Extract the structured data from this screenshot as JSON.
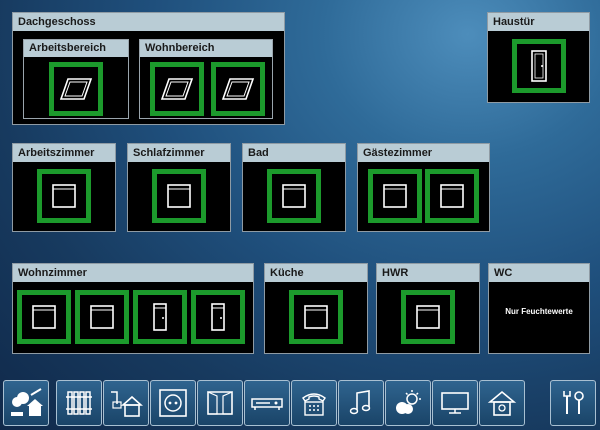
{
  "dachgeschoss": {
    "title": "Dachgeschoss",
    "arbeitsbereich": "Arbeitsbereich",
    "wohnbereich": "Wohnbereich"
  },
  "haustuer": {
    "title": "Haustür"
  },
  "rooms": {
    "arbeitszimmer": "Arbeitszimmer",
    "schlafzimmer": "Schlafzimmer",
    "bad": "Bad",
    "gaestezimmer": "Gästezimmer",
    "wohnzimmer": "Wohnzimmer",
    "kueche": "Küche",
    "hwr": "HWR",
    "wc": "WC"
  },
  "wc_note": "Nur Feuchtewerte",
  "colors": {
    "window_frame": "#1c9a2c",
    "panel_header": "#b9ccd5",
    "panel_body": "#000000"
  },
  "nav": [
    "weather-house-icon",
    "radiator-icon",
    "home-energy-icon",
    "socket-icon",
    "blinds-icon",
    "receiver-icon",
    "phone-icon",
    "music-note-icon",
    "weather-icon",
    "tv-icon",
    "home-settings-icon",
    "tools-icon"
  ]
}
